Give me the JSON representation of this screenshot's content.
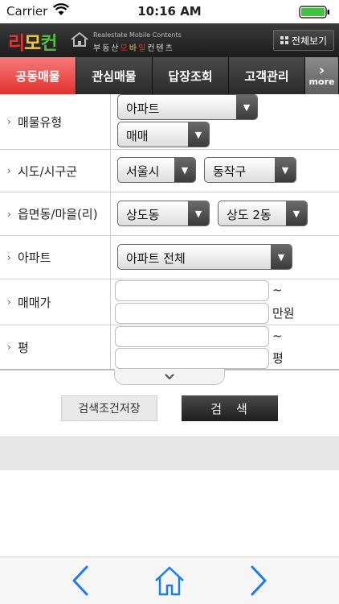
{
  "status_bar": {
    "carrier": "Carrier",
    "time": "10:16 AM"
  },
  "header": {
    "logo": [
      "리",
      "모",
      "컨"
    ],
    "brand_en": "Realestate Mobile Contents",
    "brand_kr": [
      "부동산",
      "모",
      "바",
      "일",
      "컨텐츠"
    ],
    "view_all": "전체보기"
  },
  "tabs": [
    {
      "label": "공동매물",
      "active": true
    },
    {
      "label": "관심매물",
      "active": false
    },
    {
      "label": "답장조회",
      "active": false
    },
    {
      "label": "고객관리",
      "active": false
    },
    {
      "label": "more",
      "active": false
    }
  ],
  "form": {
    "property_type": {
      "label": "매물유형",
      "type_value": "아파트",
      "deal_value": "매매"
    },
    "region": {
      "label": "시도/시구군",
      "city": "서울시",
      "district": "동작구"
    },
    "town": {
      "label": "읍면동/마을(리)",
      "dong": "상도동",
      "subdong": "상도 2동"
    },
    "apartment": {
      "label": "아파트",
      "value": "아파트 전체"
    },
    "price": {
      "label": "매매가",
      "tilde": "~",
      "unit": "만원",
      "min": "",
      "max": ""
    },
    "area": {
      "label": "평",
      "tilde": "~",
      "unit": "평",
      "min": "",
      "max": ""
    }
  },
  "buttons": {
    "save_conditions": "검색조건저장",
    "search": "검색"
  },
  "colors": {
    "accent_red": "#e2312f",
    "dark": "#2a2a2a",
    "ios_blue": "#1a7cf5"
  }
}
